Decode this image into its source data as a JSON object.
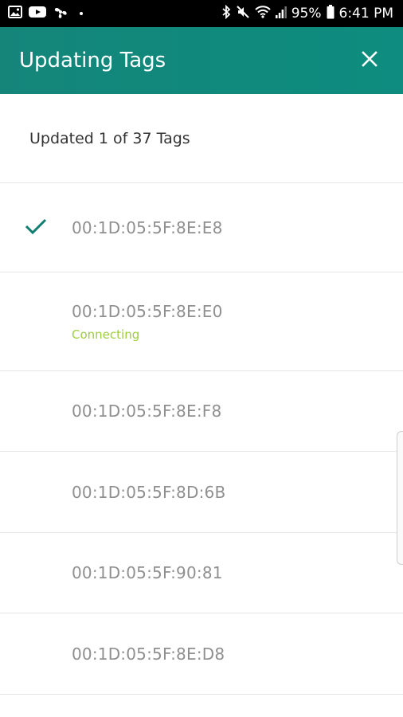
{
  "status_bar": {
    "battery_percent": "95%",
    "time": "6:41 PM",
    "left_icons": [
      "image-icon",
      "youtube-icon",
      "fan-icon",
      "dot-icon"
    ],
    "right_icons": [
      "bluetooth-icon",
      "mute-icon",
      "wifi-icon",
      "signal-icon",
      "battery-icon"
    ]
  },
  "app_bar": {
    "title": "Updating Tags",
    "close_icon": "close-icon",
    "color": "#0f8a7c"
  },
  "summary": {
    "text": "Updated 1 of 37 Tags"
  },
  "tags": [
    {
      "mac": "00:1D:05:5F:8E:E8",
      "state": "done",
      "status": ""
    },
    {
      "mac": "00:1D:05:5F:8E:E0",
      "state": "connecting",
      "status": "Connecting"
    },
    {
      "mac": "00:1D:05:5F:8E:F8",
      "state": "pending",
      "status": ""
    },
    {
      "mac": "00:1D:05:5F:8D:6B",
      "state": "pending",
      "status": ""
    },
    {
      "mac": "00:1D:05:5F:90:81",
      "state": "pending",
      "status": ""
    },
    {
      "mac": "00:1D:05:5F:8E:D8",
      "state": "pending",
      "status": ""
    }
  ],
  "colors": {
    "accent": "#0f8a7c",
    "check": "#0f7d72",
    "connecting": "#9ccd3f",
    "mac_text": "#8f8f8f"
  }
}
